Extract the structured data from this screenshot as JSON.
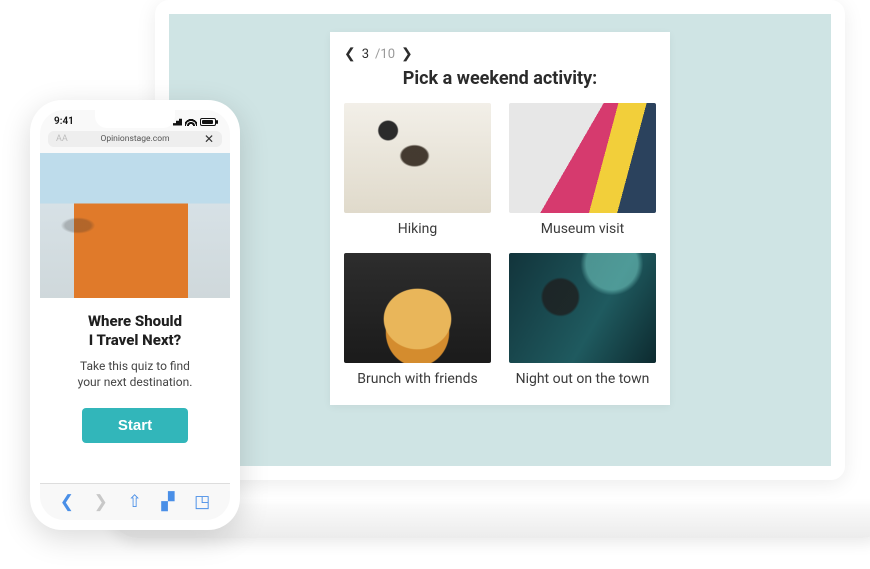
{
  "laptop": {
    "quiz": {
      "current_step": "3",
      "total_steps": "10",
      "title": "Pick a weekend activity:",
      "options": [
        {
          "label": "Hiking",
          "img": "img-hiking"
        },
        {
          "label": "Museum visit",
          "img": "img-museum"
        },
        {
          "label": "Brunch with friends",
          "img": "img-brunch"
        },
        {
          "label": "Night out on the town",
          "img": "img-night"
        }
      ]
    }
  },
  "phone": {
    "status_time": "9:41",
    "address_bar": {
      "placeholder": "AA",
      "url": "Opinionstage.com"
    },
    "quiz_intro": {
      "title_line1": "Where Should",
      "title_line2": "I Travel Next?",
      "subtitle_line1": "Take this quiz to find",
      "subtitle_line2": "your next destination.",
      "start_label": "Start"
    }
  }
}
